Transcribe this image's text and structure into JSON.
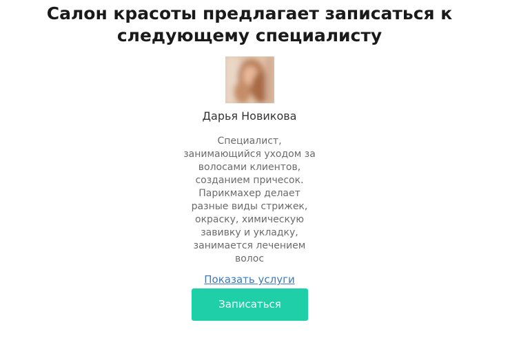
{
  "header": {
    "title": "Салон красоты предлагает записаться к следующему специалисту"
  },
  "specialist": {
    "name": "Дарья Новикова",
    "description": "Специалист, занимающийся уходом за волосами клиентов, созданием причесок. Парикмахер делает разные виды стрижек, окраску, химическую завивку и укладку, занимается лечением волос",
    "show_services_label": "Показать услуги",
    "book_label": "Записаться"
  },
  "colors": {
    "accent": "#1fcfa8",
    "link": "#3d7ab8",
    "title": "#1a1a1a",
    "description": "#6b6b6b"
  }
}
